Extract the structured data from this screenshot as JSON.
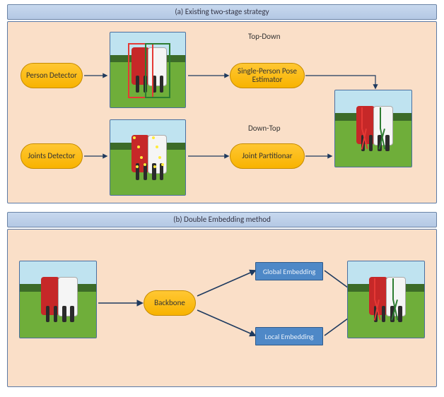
{
  "panel_a": {
    "title": "(a)  Existing two-stage strategy"
  },
  "panel_b": {
    "title": "(b)  Double Embedding method"
  },
  "labels": {
    "top_down": "Top-Down",
    "down_top": "Down-Top"
  },
  "boxes": {
    "person_detector": "Person Detector",
    "joints_detector": "Joints Detector",
    "single_person": "Single-Person Pose Estimator",
    "joint_partition": "Joint Partitionar",
    "backbone": "Backbone",
    "global_emb": "Global Embedding",
    "local_emb": "Local Embedding"
  },
  "alt": {
    "frisbee_raw": "Two frisbee players jumping",
    "frisbee_bbox": "Players with person bounding boxes",
    "frisbee_kp": "Players with detected joint keypoints",
    "frisbee_pose": "Players with full pose skeletons"
  }
}
